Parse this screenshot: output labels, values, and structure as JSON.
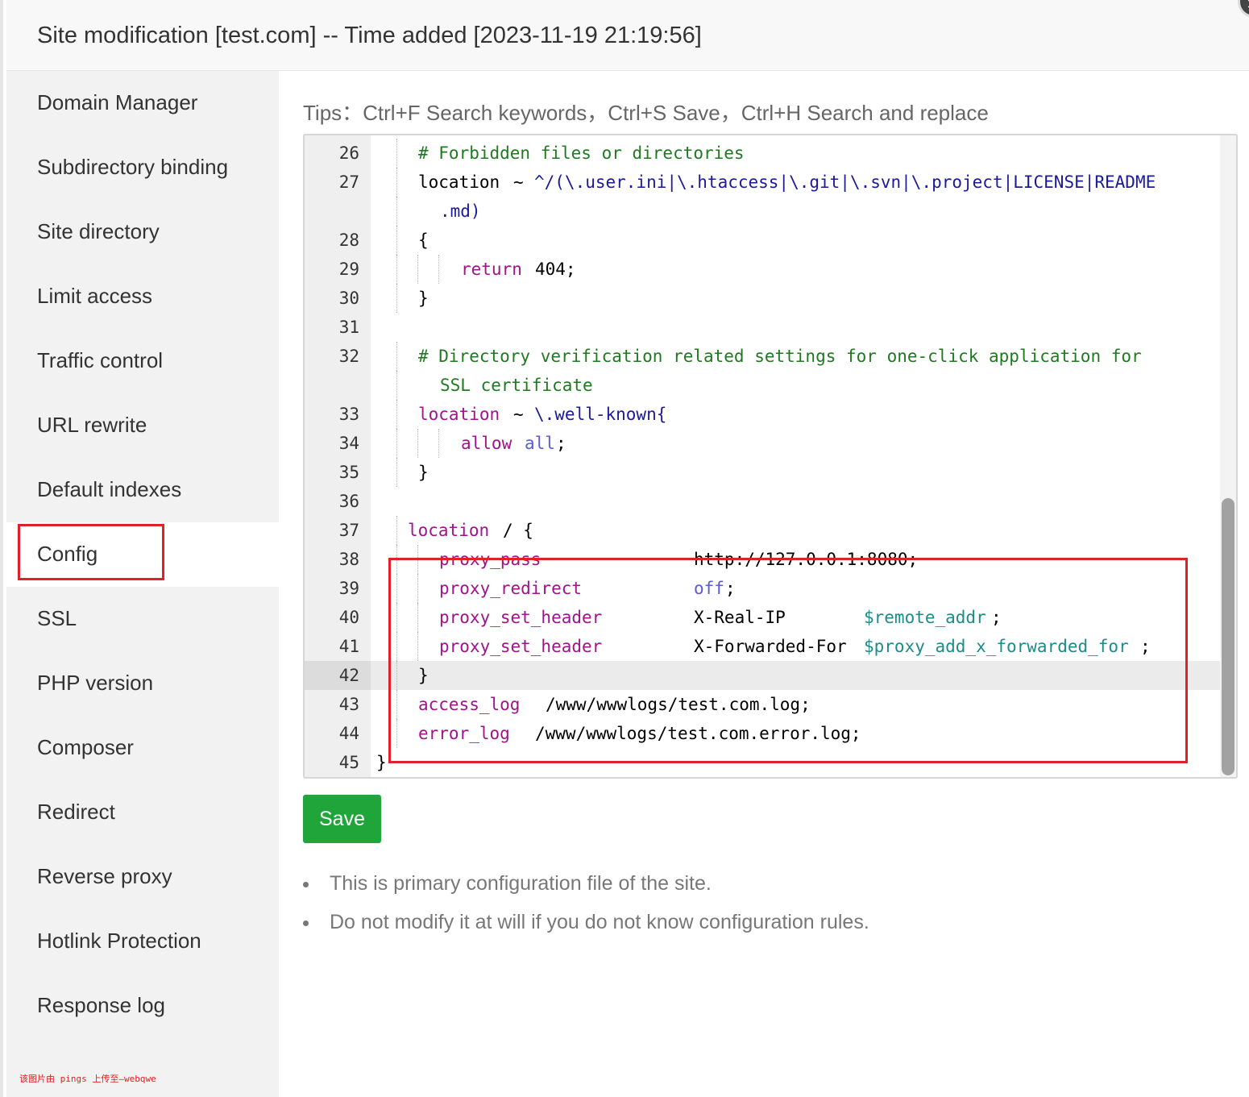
{
  "dialog": {
    "title": "Site modification [test.com] -- Time added [2023-11-19 21:19:56]"
  },
  "sidebar": {
    "items": [
      {
        "label": "Domain Manager"
      },
      {
        "label": "Subdirectory binding"
      },
      {
        "label": "Site directory"
      },
      {
        "label": "Limit access"
      },
      {
        "label": "Traffic control"
      },
      {
        "label": "URL rewrite"
      },
      {
        "label": "Default indexes"
      },
      {
        "label": "Config",
        "active": true
      },
      {
        "label": "SSL"
      },
      {
        "label": "PHP version"
      },
      {
        "label": "Composer"
      },
      {
        "label": "Redirect"
      },
      {
        "label": "Reverse proxy"
      },
      {
        "label": "Hotlink Protection"
      },
      {
        "label": "Response log"
      }
    ],
    "watermark": "该图片由 pings 上传至—webqwe"
  },
  "main": {
    "tips": "Tips：Ctrl+F Search keywords，Ctrl+S Save，Ctrl+H Search and replace",
    "editor": {
      "current_line": "42",
      "line_numbers": [
        "26",
        "27",
        "28",
        "29",
        "30",
        "31",
        "32",
        "33",
        "34",
        "35",
        "36",
        "37",
        "38",
        "39",
        "40",
        "41",
        "42",
        "43",
        "44",
        "45"
      ],
      "lines": {
        "l26": "# Forbidden files or directories",
        "l27a": "location",
        "l27b": "~",
        "l27c": "^/(\\.user.ini|\\.htaccess|\\.git|\\.svn|\\.project|LICENSE|README",
        "l27d": ".md)",
        "l28": "{",
        "l29a": "return",
        "l29b": "404;",
        "l30": "}",
        "l32a": "# Directory verification related settings for one-click application for",
        "l32b": "SSL certificate",
        "l33a": "location",
        "l33b": "~",
        "l33c": "\\.well-known{",
        "l34a": "allow",
        "l34b": "all",
        "l34c": ";",
        "l35": "}",
        "l37a": "location",
        "l37b": "/ {",
        "l38a": "proxy_pass",
        "l38b": "http://127.0.0.1:8080;",
        "l39a": "proxy_redirect",
        "l39b": "off",
        "l39c": ";",
        "l40a": "proxy_set_header",
        "l40b": "X-Real-IP",
        "l40c": "$remote_addr",
        "l40d": ";",
        "l41a": "proxy_set_header",
        "l41b": "X-Forwarded-For",
        "l41c": "$proxy_add_x_forwarded_for",
        "l41d": ";",
        "l42": "}",
        "l43a": "access_log",
        "l43b": "/www/wwwlogs/test.com.log;",
        "l44a": "error_log",
        "l44b": "/www/wwwlogs/test.com.error.log;",
        "l45": "}"
      }
    },
    "save_label": "Save",
    "notes": [
      "This is primary configuration file of the site.",
      "Do not modify it at will if you do not know configuration rules."
    ]
  },
  "colors": {
    "accent_green": "#20a53a",
    "annotation_red": "#e0212b",
    "keyword_purple": "#a0138b",
    "comment_green": "#1f7a1f"
  }
}
